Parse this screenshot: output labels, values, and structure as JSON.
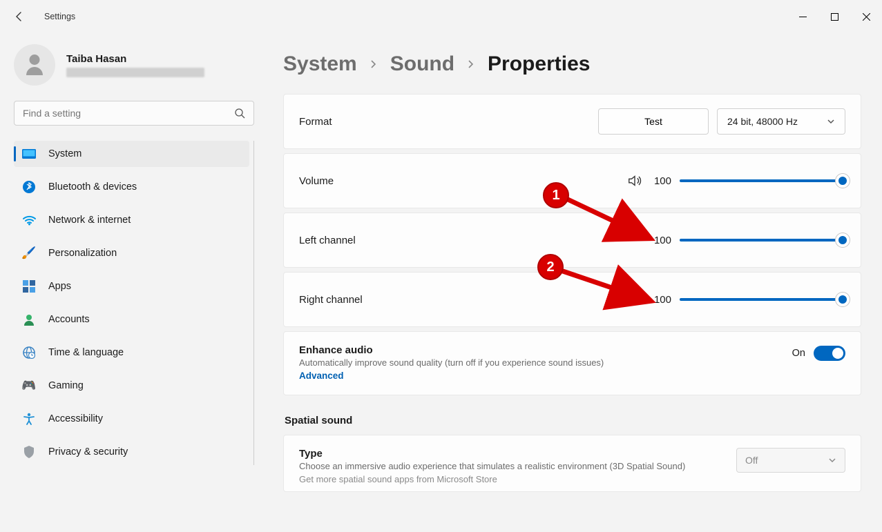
{
  "app": {
    "title": "Settings"
  },
  "profile": {
    "name": "Taiba Hasan"
  },
  "search": {
    "placeholder": "Find a setting"
  },
  "sidebar": {
    "items": [
      {
        "label": "System"
      },
      {
        "label": "Bluetooth & devices"
      },
      {
        "label": "Network & internet"
      },
      {
        "label": "Personalization"
      },
      {
        "label": "Apps"
      },
      {
        "label": "Accounts"
      },
      {
        "label": "Time & language"
      },
      {
        "label": "Gaming"
      },
      {
        "label": "Accessibility"
      },
      {
        "label": "Privacy & security"
      }
    ]
  },
  "breadcrumb": {
    "a": "System",
    "b": "Sound",
    "c": "Properties"
  },
  "format": {
    "label": "Format",
    "test": "Test",
    "selected": "24 bit, 48000 Hz"
  },
  "volume": {
    "label": "Volume",
    "value": "100"
  },
  "left": {
    "label": "Left channel",
    "value": "100"
  },
  "right": {
    "label": "Right channel",
    "value": "100"
  },
  "enhance": {
    "title": "Enhance audio",
    "sub": "Automatically improve sound quality (turn off if you experience sound issues)",
    "link": "Advanced",
    "state": "On"
  },
  "spatial": {
    "heading": "Spatial sound",
    "title": "Type",
    "sub": "Choose an immersive audio experience that simulates a realistic environment (3D Spatial Sound)",
    "more": "Get more spatial sound apps from Microsoft Store",
    "selected": "Off"
  },
  "anno": {
    "one": "1",
    "two": "2"
  }
}
